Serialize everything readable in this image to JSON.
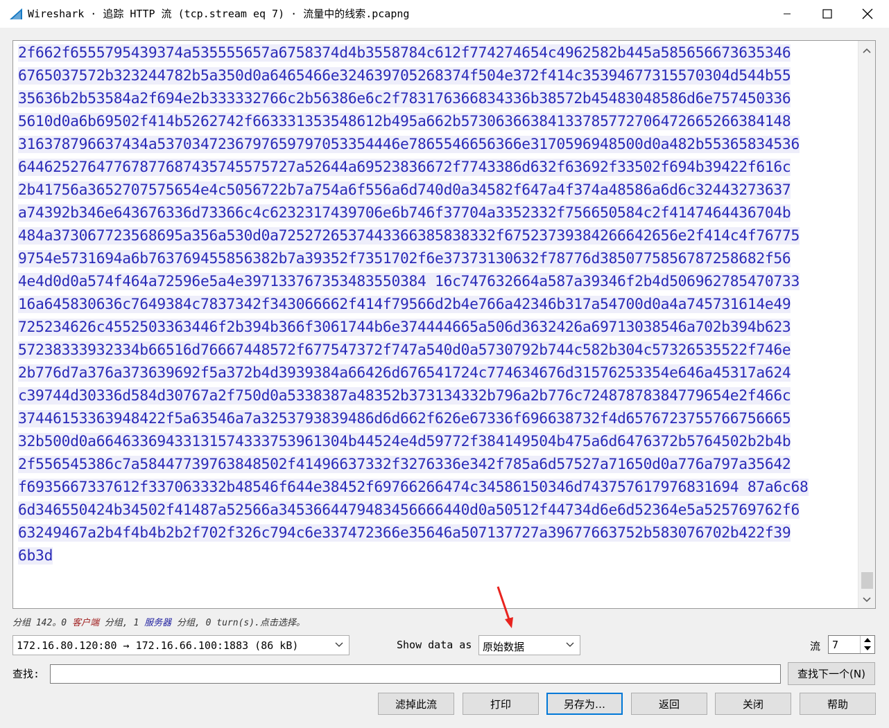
{
  "window": {
    "title": "Wireshark · 追踪 HTTP 流 (tcp.stream eq 7) · 流量中的线索.pcapng"
  },
  "stream": {
    "lines": [
      "2f662f6555795439374a535555657a6758374d4b3558784c612f774274654c4962582b445a585656673635346",
      "6765037572b323244782b5a350d0a6465466e324639705268374f504e372f414c35394677315570304d544b55",
      "35636b2b53584a2f694e2b333332766c2b56386e6c2f783176366834336b38572b45483048586d6e757450336",
      "5610d0a6b69502f414b5262742f663331353548612b495a662b57306366384133785772706472665266384148",
      "316378796637434a5370347236797659797053354446e7865546656366e3170596948500d0a482b55365834536",
      "64462527647767877687435745575727a52644a69523836672f7743386d632f63692f33502f694b39422f616c",
      "2b41756a3652707575654e4c5056722b7a754a6f556a6d740d0a34582f647a4f374a48586a6d6c32443273637",
      "a74392b346e643676336d73366c4c6232317439706e6b746f37704a3352332f756650584c2f4147464436704b",
      "484a373067723568695a356a530d0a7252726537443366385838332f67523739384266642656e2f414c4f76775",
      "9754e5731694a6b763769455856382b7a39352f7351702f6e37373130632f78776d3850775856787258682f56",
      "4e4d0d0a574f464a72596e5a4e397133767353483550384 16c747632664a587a39346f2b4d506962785470733",
      "16a645830636c7649384c7837342f343066662f414f79566d2b4e766a42346b317a54700d0a4a745731614e49",
      "725234626c4552503363446f2b394b366f3061744b6e374444665a506d3632426a69713038546a702b394b623",
      "57238333932334b66516d76667448572f677547372f747a540d0a5730792b744c582b304c57326535522f746e",
      "2b776d7a376a373639692f5a372b4d3939384a66426d676541724c774634676d31576253354e646a45317a624",
      "c39744d30336d584d30767a2f750d0a5338387a48352b373134332b796a2b776c72487878384779654e2f466c",
      "37446153363948422f5a63546a7a3253793839486d6d662f626e67336f696638732f4d6576723755766756665",
      "32b500d0a66463369433131574333753961304b44524e4d59772f384149504b475a6d6476372b5764502b2b4b",
      "2f556545386c7a58447739763848502f41496637332f3276336e342f785a6d57527a71650d0a776a797a35642",
      "f6935667337612f337063332b48546f644e38452f69766266474c34586150346d743757617976831694 87a6c68",
      "6d346550424b34502f41487a52566a3453664479483456666440d0a50512f44734d6e6d52364e5a525769762f6",
      "63249467a2b4f4b4b2b2f702f326c794c6e337472366e35646a507137727a39677663752b583076702b422f39",
      "6b3d"
    ]
  },
  "status": {
    "prefix": "分组 142。0 ",
    "client_label": "客户端",
    "middle": " 分组, 1 ",
    "server_label": "服务器",
    "suffix": " 分组, 0 turn(s).点击选择。"
  },
  "conversation_select": {
    "value": "172.16.80.120:80 → 172.16.66.100:1883 (86 kB)"
  },
  "show_data": {
    "label": "Show data as",
    "value": "原始数据"
  },
  "stream_spin": {
    "label": "流",
    "value": "7"
  },
  "find": {
    "label": "查找:",
    "placeholder": "",
    "next_button": "查找下一个(N)"
  },
  "buttons": {
    "filter_out": "滤掉此流",
    "print": "打印",
    "save_as": "另存为…",
    "back": "返回",
    "close": "关闭",
    "help": "帮助"
  },
  "colors": {
    "client_text": "#2a2ab8",
    "client_bg": "#eeeefa",
    "annotation_arrow": "#e8231e",
    "focus_border": "#0078d7"
  }
}
